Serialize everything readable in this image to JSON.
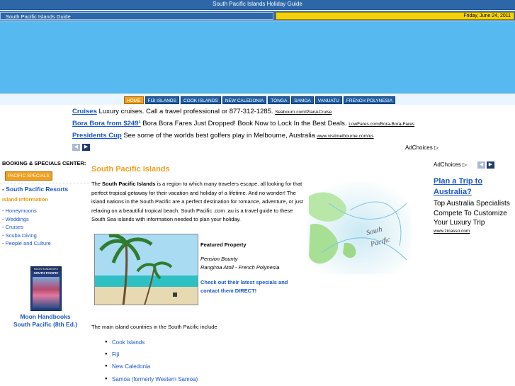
{
  "header": {
    "title": "South Pacific Islands Holiday Guide",
    "site_name": "South Pacific Islands Guide",
    "date": "Friday, June 24, 2011"
  },
  "nav": {
    "items": [
      {
        "label": "HOME",
        "active": true
      },
      {
        "label": "FIJI ISLANDS",
        "active": false
      },
      {
        "label": "COOK ISLANDS",
        "active": false
      },
      {
        "label": "NEW CALEDONIA",
        "active": false
      },
      {
        "label": "TONGA",
        "active": false
      },
      {
        "label": "SAMOA",
        "active": false
      },
      {
        "label": "VANUATU",
        "active": false
      },
      {
        "label": "FRENCH POLYNESIA",
        "active": false
      }
    ]
  },
  "top_ads": [
    {
      "link": "Cruises",
      "text": "Luxury cruises. Call a travel professional or 877-312-1285.",
      "url": "Seabourn.com/PlanACruise"
    },
    {
      "link": "Bora Bora from $249¹",
      "text": "Bora Bora Fares Just Dropped! Book Now to Lock In the Best Deals.",
      "url": "LowFares.com/Bora-Bora-Fares"
    },
    {
      "link": "Presidents Cup",
      "text": "See some of the worlds best golfers play in Melbourne, Australia",
      "url": "www.visitmelbourne.com/us"
    }
  ],
  "adchoices_label": "AdChoices",
  "left": {
    "booking_title": "BOOKING & SPECIALS CENTER:",
    "specials_button": "PACIFIC SPECIALS",
    "resorts_link": "South Pacific Resorts",
    "island_info_title": "Island Information",
    "info_links": [
      "Honeymoons",
      "Weddings",
      "Cruises",
      "Scuba Diving",
      "People and Culture"
    ],
    "book": {
      "cover_publisher": "MOON HANDBOOKS",
      "cover_title": "SOUTH PACIFIC",
      "caption_line1": "Moon Handbooks",
      "caption_line2": "South Pacific (8th Ed.)"
    }
  },
  "main": {
    "title": "South Pacific Islands",
    "intro_bold": "South Pacific Islands",
    "intro_pre": "The ",
    "intro_rest": " is a region to which many travelers escape, all looking for that perfect tropical getaway for their vacation and holiday of a lifetime. And no wonder! The island nations in the South Pacific are a perfect destination for romance, adventure, or just relaxing on a beautiful tropical beach. South Pacific .com .au is a travel guide to these South Sea islands with information needed to plan your holiday.",
    "map_label_line1": "South",
    "map_label_line2": "Pacific",
    "featured": {
      "title": "Featured Property",
      "name": "Pension Bounty",
      "location": "Rangiroa Atoll - French Polynesia",
      "cta": "Check out their latest specials and contact them DIRECT!"
    },
    "countries_intro": "The main island countries in the South Pacific include",
    "countries": [
      "Cook Islands",
      "Fiji",
      "New Caledonia",
      "Samoa (formerly Western Samoa)"
    ]
  },
  "right_ad": {
    "title": "Plan a Trip to Australia?",
    "body": "Top Australia Specialists Compete To Customize Your Luxury Trip",
    "url": "www.zicasso.com"
  },
  "colors": {
    "header_blue": "#2d67a8",
    "banner_sky": "#56baf0",
    "accent_orange": "#f0a020",
    "date_yellow": "#f4d20a",
    "link_blue": "#1a57c9"
  }
}
